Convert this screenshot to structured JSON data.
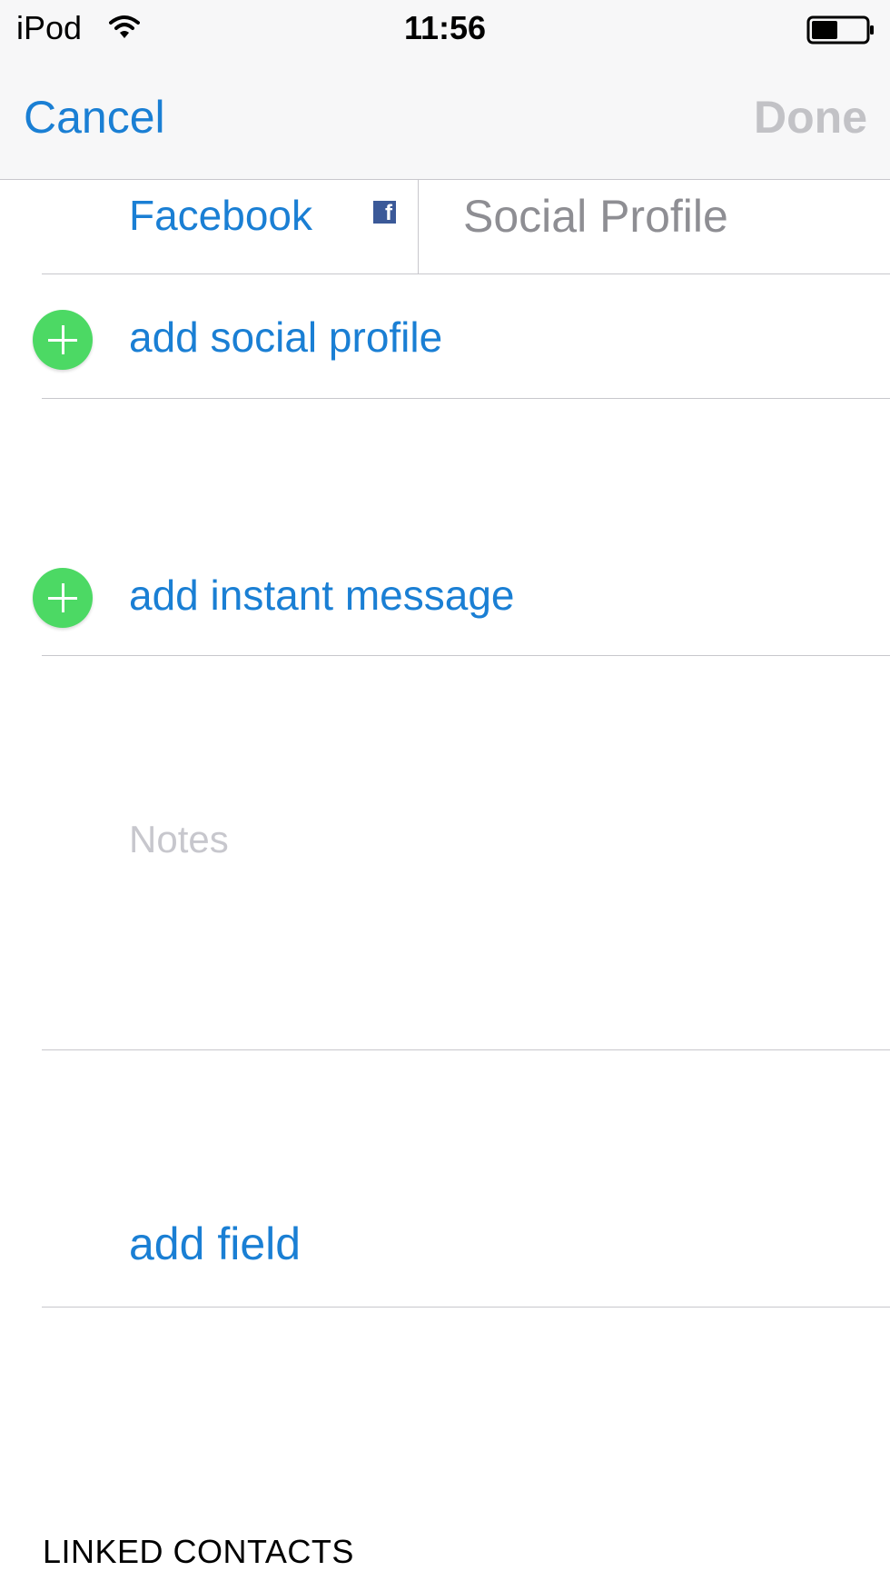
{
  "status_bar": {
    "carrier": "iPod",
    "time": "11:56"
  },
  "nav": {
    "cancel_label": "Cancel",
    "done_label": "Done"
  },
  "social": {
    "service_label": "Facebook",
    "profile_placeholder": "Social Profile",
    "add_label": "add social profile"
  },
  "instant_message": {
    "add_label": "add instant message"
  },
  "notes": {
    "placeholder": "Notes"
  },
  "add_field_label": "add field",
  "linked_contacts_header": "LINKED CONTACTS",
  "colors": {
    "accent": "#1a7fd4",
    "add_green": "#4cd964",
    "separator": "#c8c7cc",
    "placeholder": "#c7c7cd"
  },
  "icons": [
    "wifi-icon",
    "battery-icon",
    "facebook-icon",
    "plus-icon"
  ]
}
